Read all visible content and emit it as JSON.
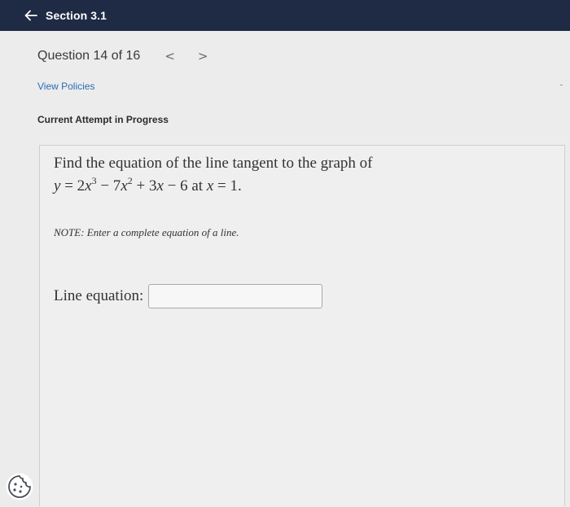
{
  "header": {
    "back_label": "Section 3.1"
  },
  "question": {
    "title": "Question 14 of 16",
    "prev_arrow": "<",
    "next_arrow": ">",
    "policies_link": "View Policies",
    "attempt_status": "Current Attempt in Progress",
    "prompt_line1": "Find the equation of the line tangent to the graph of",
    "equation": {
      "y": "y",
      "equals": " = 2",
      "x1": "x",
      "exp1": "3",
      "minus7": " − 7",
      "x2": "x",
      "exp2": "2",
      "plus3": " + 3",
      "x3": "x",
      "minus6": " − 6 at ",
      "x4": "x",
      "tail": " = 1."
    },
    "note": "NOTE: Enter a complete equation of a line.",
    "answer_label": "Line equation:",
    "answer_value": ""
  },
  "colors": {
    "header_bg": "#1f2a44",
    "link": "#2a6db5"
  },
  "icons": {
    "back": "arrow-left-icon",
    "cookie": "cookie-icon"
  }
}
